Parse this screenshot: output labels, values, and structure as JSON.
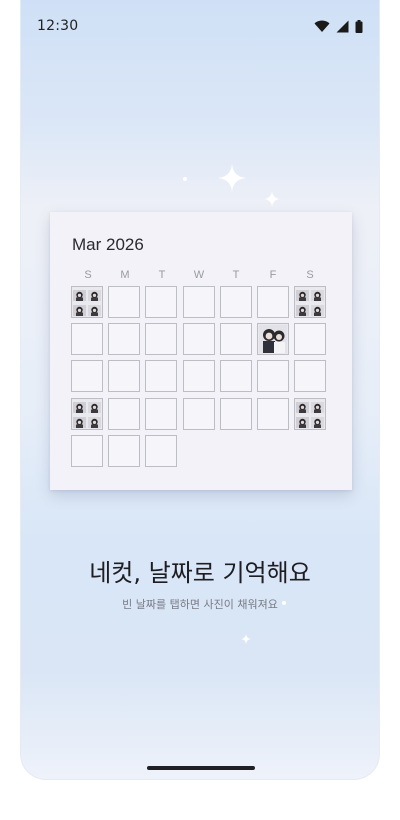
{
  "status_bar": {
    "time": "12:30"
  },
  "calendar": {
    "month_title": "Mar 2026",
    "weekdays": [
      "S",
      "M",
      "T",
      "W",
      "T",
      "F",
      "S"
    ]
  },
  "onboarding": {
    "headline": "네컷, 날짜로 기억해요",
    "subline": "빈 날짜를 탭하면 사진이 채워져요"
  },
  "colors": {
    "background_top": "#cfe0f6",
    "card": "#f2f2f8",
    "headline": "#1d1d22"
  }
}
